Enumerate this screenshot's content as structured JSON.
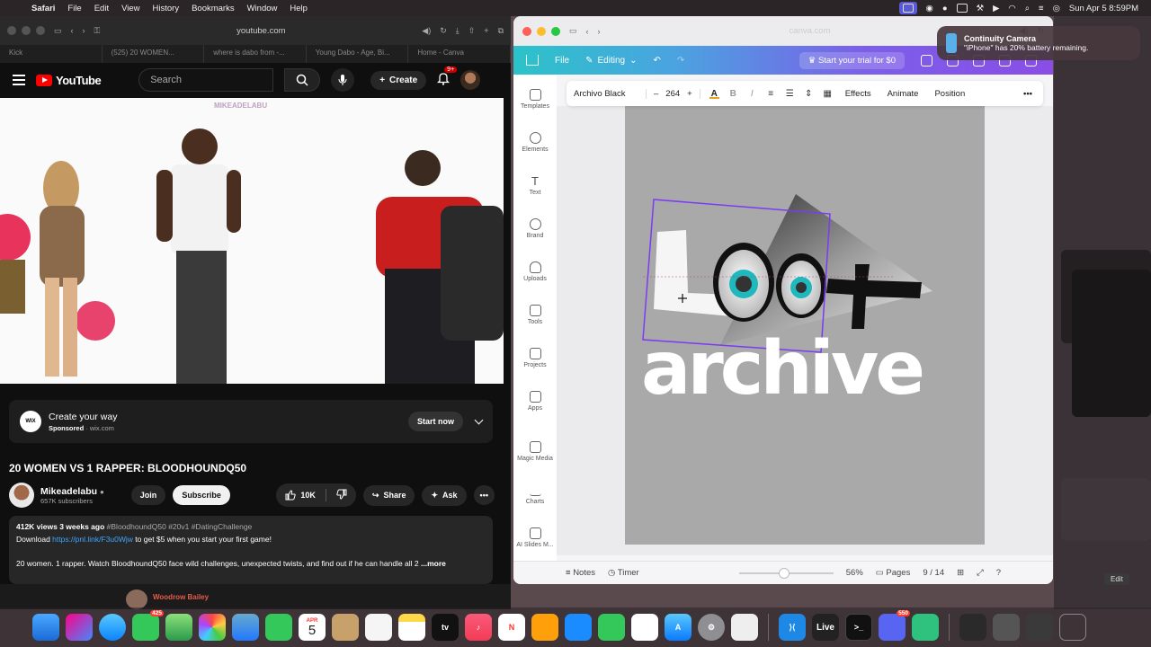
{
  "menubar": {
    "app": "Safari",
    "items": [
      "File",
      "Edit",
      "View",
      "History",
      "Bookmarks",
      "Window",
      "Help"
    ],
    "clock": "Sun Apr 5  8:59PM"
  },
  "safari": {
    "url": "youtube.com",
    "tabs": [
      "Kick",
      "(525) 20 WOMEN...",
      "where is dabo from -...",
      "Young Dabo - Age, Bi...",
      "Home - Canva"
    ]
  },
  "youtube": {
    "logo": "YouTube",
    "search_placeholder": "Search",
    "create_label": "Create",
    "notif_count": "9+",
    "video_watermark": "MIKEADELABU",
    "ad": {
      "logo": "WIX",
      "title": "Create your way",
      "sponsored": "Sponsored",
      "domain": "wix.com",
      "cta": "Start now"
    },
    "video_title": "20 WOMEN VS 1 RAPPER: BLOODHOUNDQ50",
    "channel": {
      "name": "Mikeadelabu",
      "subscribers": "657K subscribers",
      "join": "Join",
      "subscribe": "Subscribe"
    },
    "actions": {
      "likes": "10K",
      "share": "Share",
      "ask": "Ask"
    },
    "description": {
      "stats": "412K views  3 weeks ago",
      "tags": "#BloodhoundQ50 #20v1 #DatingChallenge",
      "download_prefix": "Download ",
      "link": "https://pnl.link/F3u0Wjw",
      "download_suffix": " to get $5 when you start your first game!",
      "body": "20 women. 1 rapper. Watch BloodhoundQ50 face wild challenges, unexpected twists, and find out if he can handle all 2",
      "more": "...more"
    },
    "comment_author": "Woodrow Bailey"
  },
  "canva": {
    "url": "canva.com",
    "header": {
      "file": "File",
      "editing": "Editing",
      "trial": "Start your trial for $0"
    },
    "sidebar": [
      {
        "label": "Templates"
      },
      {
        "label": "Elements"
      },
      {
        "label": "Text"
      },
      {
        "label": "Brand"
      },
      {
        "label": "Uploads"
      },
      {
        "label": "Tools"
      },
      {
        "label": "Projects"
      },
      {
        "label": "Apps"
      },
      {
        "label": "Magic Media"
      },
      {
        "label": "Charts"
      },
      {
        "label": "AI Slides M..."
      }
    ],
    "context": {
      "font": "Archivo Black",
      "size": "264",
      "effects": "Effects",
      "animate": "Animate",
      "position": "Position"
    },
    "design_text": "archive",
    "bottom": {
      "notes": "Notes",
      "timer": "Timer",
      "zoom": "56%",
      "pages": "Pages",
      "page_count": "9 / 14"
    }
  },
  "notification": {
    "title": "Continuity Camera",
    "body": "\"iPhone\" has 20% battery remaining."
  },
  "dock": {
    "calendar_month": "APR",
    "calendar_day": "5",
    "messages_badge": "425",
    "discord_badge": "550",
    "live_label": "Live"
  },
  "edit_tag": "Edit"
}
